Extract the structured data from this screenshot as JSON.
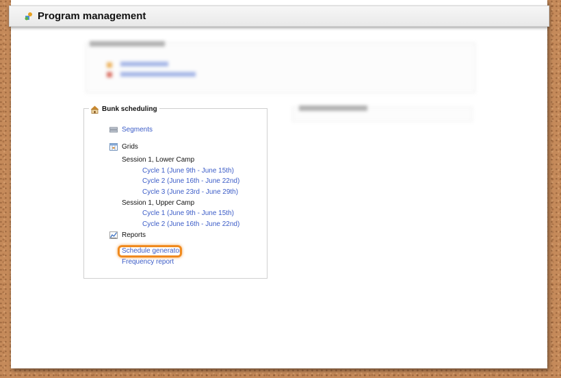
{
  "header": {
    "title": "Program management",
    "icon": "program-management-icon"
  },
  "bunk_scheduling": {
    "legend": "Bunk scheduling",
    "legend_icon": "house-icon",
    "segments_link": "Segments",
    "grids_label": "Grids",
    "sessions": [
      {
        "name": "Session 1, Lower Camp",
        "cycles": [
          "Cycle 1 (June 9th - June 15th)",
          "Cycle 2 (June 16th - June 22nd)",
          "Cycle 3 (June 23rd - June 29th)"
        ]
      },
      {
        "name": "Session 1, Upper Camp",
        "cycles": [
          "Cycle 1 (June 9th - June 15th)",
          "Cycle 2 (June 16th - June 22nd)"
        ]
      }
    ],
    "reports_label": "Reports",
    "report_links": [
      "Schedule generator",
      "Frequency report"
    ],
    "highlight_color": "#f08a1e"
  },
  "colors": {
    "link": "#3a5bc7",
    "accent_orange": "#f08a1e"
  }
}
